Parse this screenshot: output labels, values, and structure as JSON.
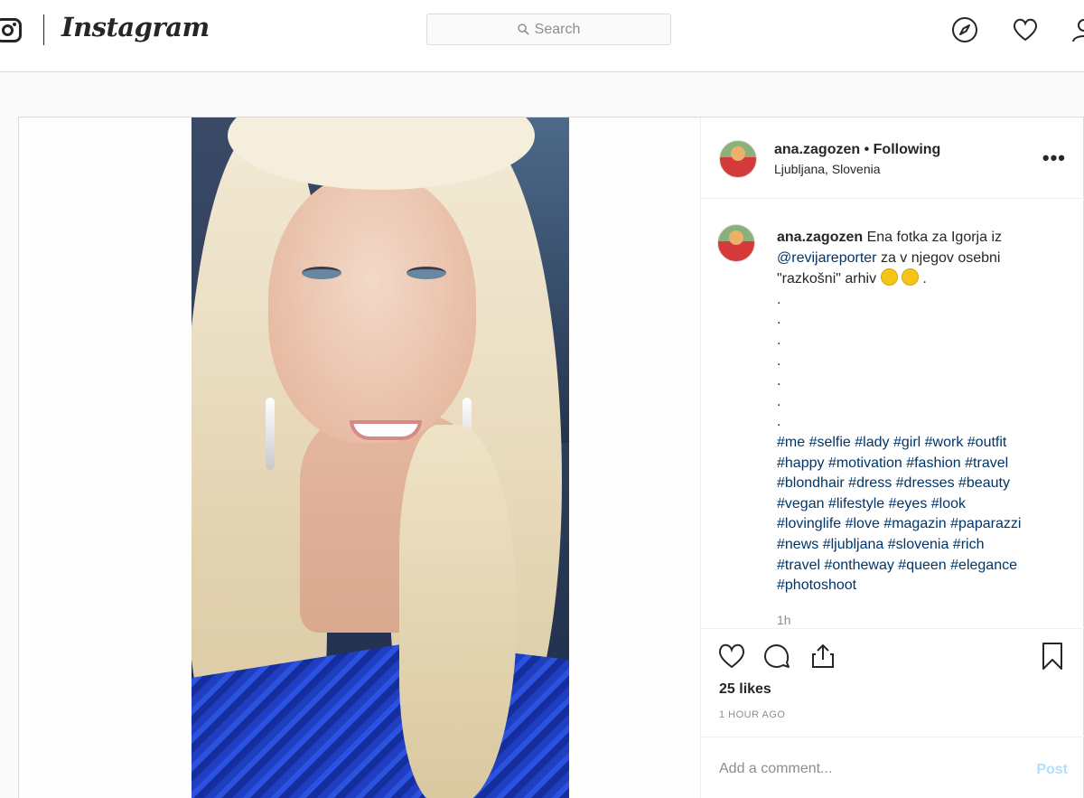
{
  "header": {
    "wordmark": "Instagram",
    "search_placeholder": "Search",
    "icons": [
      "instagram-glyph-icon",
      "search-icon",
      "explore-compass-icon",
      "activity-heart-icon",
      "profile-icon"
    ]
  },
  "post": {
    "username": "ana.zagozen",
    "separator": "•",
    "follow_status": "Following",
    "location": "Ljubljana, Slovenia",
    "more_label": "•••",
    "caption": {
      "username": "ana.zagozen",
      "text_1": "Ena fotka za Igorja iz",
      "mention": "@revijareporter",
      "text_2": "za v njegov osebni \"razkošni\" arhiv",
      "emoji": [
        "winking-face-emoji",
        "grinning-squinting-face-emoji"
      ],
      "text_end": ".",
      "dot_lines": [
        ".",
        ".",
        ".",
        ".",
        ".",
        ".",
        "."
      ],
      "hashtag_lines": [
        "#me #selfie #lady #girl #work #outfit",
        "#happy #motivation #fashion #travel",
        "#blondhair #dress #dresses #beauty",
        "#vegan #lifestyle #eyes #look",
        "#lovinglife #love #magazin #paparazzi",
        "#news #ljubljana #slovenia #rich",
        "#travel #ontheway #queen #elegance",
        "#photoshoot"
      ],
      "time": "1h"
    },
    "likes": "25 likes",
    "posted_ago": "1 HOUR AGO",
    "comment_placeholder": "Add a comment...",
    "post_button": "Post",
    "colors": {
      "link": "#003569",
      "post_button_disabled": "#b2dffc",
      "muted": "#8e8e8e",
      "border": "#dbdbdb"
    }
  }
}
